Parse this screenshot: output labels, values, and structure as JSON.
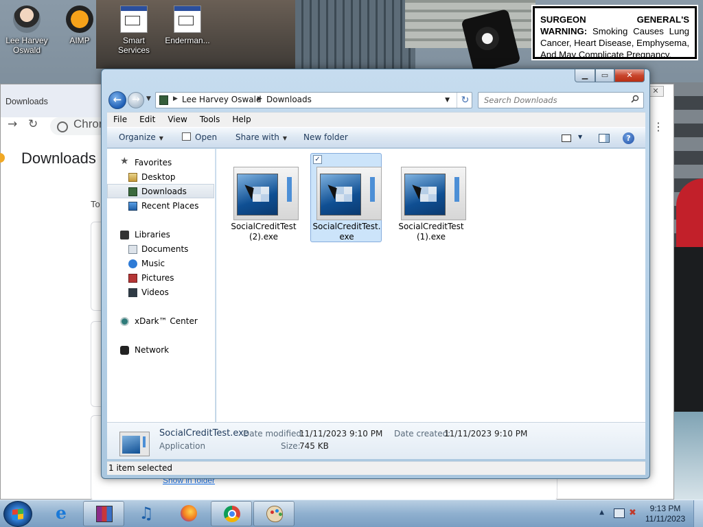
{
  "desktop": {
    "icons": [
      {
        "label": "Lee Harvey Oswald",
        "icon": "user-folder-icon"
      },
      {
        "label": "AIMP",
        "icon": "aimp-icon"
      },
      {
        "label": "Smart Services",
        "icon": "services-icon"
      },
      {
        "label": "Enderman...",
        "icon": "app-icon"
      }
    ],
    "warning": {
      "bold": "SURGEON GENERAL'S WARNING:",
      "text": " Smoking Causes Lung Cancer, Heart Disease, Emphysema, And May Complicate Pregnancy."
    }
  },
  "chrome": {
    "tab_title": "Downloads",
    "omnibox": "Chrom",
    "page_title": "Downloads",
    "today_label": "To",
    "show_in_folder": "Show in folder"
  },
  "explorer": {
    "breadcrumb": [
      "Lee Harvey Oswald",
      "Downloads"
    ],
    "search_placeholder": "Search Downloads",
    "menu": [
      "File",
      "Edit",
      "View",
      "Tools",
      "Help"
    ],
    "toolbar": {
      "organize": "Organize",
      "open": "Open",
      "share_with": "Share with",
      "new_folder": "New folder",
      "help": "?"
    },
    "nav": {
      "favorites": "Favorites",
      "desktop": "Desktop",
      "downloads": "Downloads",
      "recent_places": "Recent Places",
      "libraries": "Libraries",
      "documents": "Documents",
      "music": "Music",
      "pictures": "Pictures",
      "videos": "Videos",
      "xdark": "xDark™ Center",
      "network": "Network"
    },
    "files": [
      {
        "line1": "SocialCreditTest",
        "line2": "(2).exe",
        "selected": false
      },
      {
        "line1": "SocialCreditTest.",
        "line2": "exe",
        "selected": true
      },
      {
        "line1": "SocialCreditTest",
        "line2": "(1).exe",
        "selected": false
      }
    ],
    "details": {
      "name": "SocialCreditTest.exe",
      "type": "Application",
      "modified_label": "Date modified:",
      "modified_value": "11/11/2023 9:10 PM",
      "created_label": "Date created:",
      "created_value": "11/11/2023 9:10 PM",
      "size_label": "Size:",
      "size_value": "745 KB"
    },
    "status": "1 item selected"
  },
  "taskbar": {
    "apps": [
      "internet-explorer",
      "winrar",
      "music-player",
      "firefox",
      "chrome",
      "paint"
    ],
    "time": "9:13 PM",
    "date": "11/11/2023"
  }
}
